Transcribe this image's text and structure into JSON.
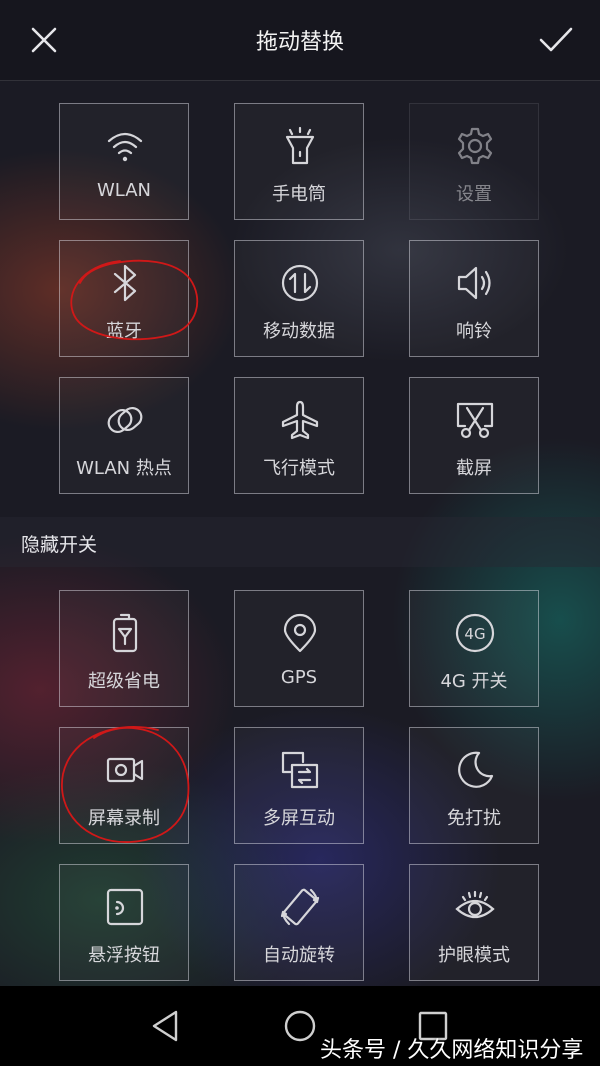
{
  "header": {
    "title": "拖动替换",
    "close_icon": "close-icon",
    "confirm_icon": "check-icon"
  },
  "active_tiles": [
    {
      "label": "WLAN",
      "icon": "wifi-icon",
      "dimmed": false
    },
    {
      "label": "手电筒",
      "icon": "flashlight-icon",
      "dimmed": false
    },
    {
      "label": "设置",
      "icon": "gear-icon",
      "dimmed": true
    },
    {
      "label": "蓝牙",
      "icon": "bluetooth-icon",
      "dimmed": false
    },
    {
      "label": "移动数据",
      "icon": "mobile-data-icon",
      "dimmed": false
    },
    {
      "label": "响铃",
      "icon": "speaker-icon",
      "dimmed": false
    },
    {
      "label": "WLAN 热点",
      "icon": "hotspot-icon",
      "dimmed": false
    },
    {
      "label": "飞行模式",
      "icon": "airplane-icon",
      "dimmed": false
    },
    {
      "label": "截屏",
      "icon": "screenshot-icon",
      "dimmed": false
    }
  ],
  "hidden_section": {
    "title": "隐藏开关",
    "tiles": [
      {
        "label": "超级省电",
        "icon": "battery-saver-icon"
      },
      {
        "label": "GPS",
        "icon": "location-pin-icon"
      },
      {
        "label": "4G 开关",
        "icon": "4g-icon"
      },
      {
        "label": "屏幕录制",
        "icon": "screen-record-icon"
      },
      {
        "label": "多屏互动",
        "icon": "multi-screen-icon"
      },
      {
        "label": "免打扰",
        "icon": "moon-icon"
      },
      {
        "label": "悬浮按钮",
        "icon": "floating-button-icon"
      },
      {
        "label": "自动旋转",
        "icon": "auto-rotate-icon"
      },
      {
        "label": "护眼模式",
        "icon": "eye-icon"
      }
    ]
  },
  "annotations": {
    "color": "#d01818",
    "circled_tiles": [
      "蓝牙",
      "屏幕录制"
    ]
  },
  "nav_bar": {
    "back_icon": "back-triangle-icon",
    "home_icon": "home-circle-icon",
    "recent_icon": "recent-square-icon"
  },
  "watermark": "头条号 / 久久网络知识分享",
  "colors": {
    "background": "#1b1b24",
    "tile_border": "#ebebf5",
    "text": "#d6d6da",
    "nav_bar": "#000000"
  }
}
